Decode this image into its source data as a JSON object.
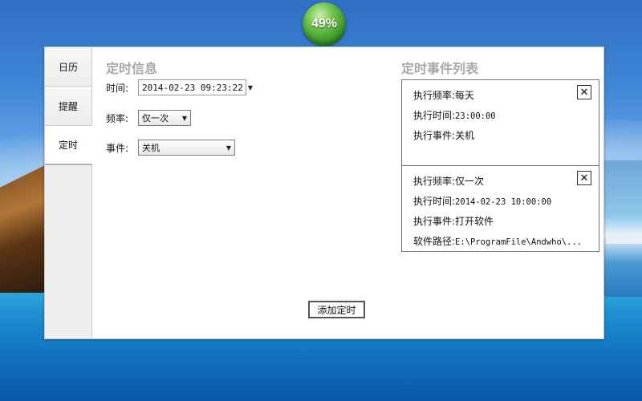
{
  "battery": {
    "label": "49%",
    "level": 49
  },
  "sidebar": {
    "tabs": [
      {
        "label": "日历",
        "active": false
      },
      {
        "label": "提醒",
        "active": false
      },
      {
        "label": "定时",
        "active": true
      }
    ]
  },
  "form": {
    "title": "定时信息",
    "time": {
      "label": "时间:",
      "value": "2014-02-23 09:23:22"
    },
    "frequency": {
      "label": "频率:",
      "value": "仅一次"
    },
    "event": {
      "label": "事件:",
      "value": "关机"
    },
    "add_button": "添加定时"
  },
  "event_list": {
    "title": "定时事件列表",
    "items": [
      {
        "freq_label": "执行频率:",
        "freq": "每天",
        "time_label": "执行时间:",
        "time": "23:00:00",
        "event_label": "执行事件:",
        "event": "关机",
        "close": "✕"
      },
      {
        "freq_label": "执行频率:",
        "freq": "仅一次",
        "time_label": "执行时间:",
        "time": "2014-02-23 10:00:00",
        "event_label": "执行事件:",
        "event": "打开软件",
        "path_label": "软件路径:",
        "path": "E:\\ProgramFile\\Andwho\\...",
        "close": "✕"
      }
    ]
  },
  "colors": {
    "title_gray": "#a8a8a8",
    "window_bg": "#ffffff",
    "battery_green": "#4aa834"
  }
}
